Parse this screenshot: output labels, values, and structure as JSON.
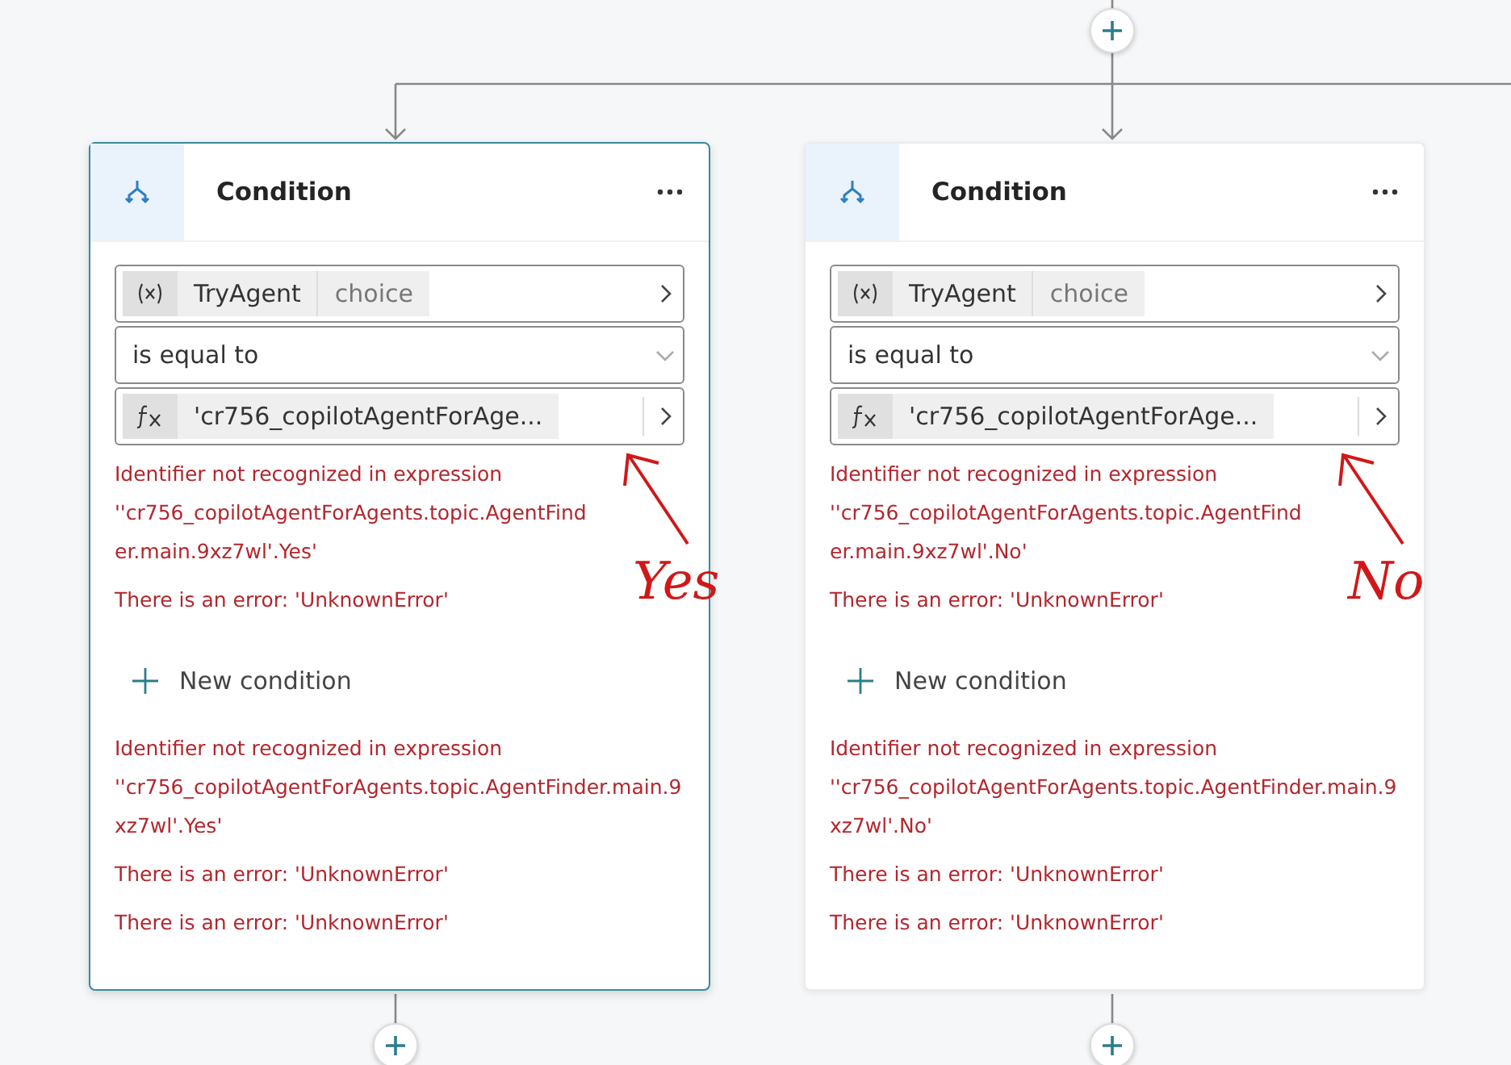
{
  "branches": [
    {
      "title": "Condition",
      "selected": true,
      "variable": {
        "name": "TryAgent",
        "type": "choice"
      },
      "operator": "is equal to",
      "value": "'cr756_copilotAgentForAge...",
      "errors_top": [
        "Identifier not recognized in expression ''cr756_copilotAgentForAgents.topic.AgentFinder.main.9xz7wl'.Yes'",
        "There is an error: 'UnknownError'"
      ],
      "new_condition": "New condition",
      "errors_bottom": [
        "Identifier not recognized in expression ''cr756_copilotAgentForAgents.topic.AgentFinder.main.9xz7wl'.Yes'",
        "There is an error: 'UnknownError'",
        "There is an error: 'UnknownError'"
      ],
      "annotation": "Yes"
    },
    {
      "title": "Condition",
      "selected": false,
      "variable": {
        "name": "TryAgent",
        "type": "choice"
      },
      "operator": "is equal to",
      "value": "'cr756_copilotAgentForAge...",
      "errors_top": [
        "Identifier not recognized in expression ''cr756_copilotAgentForAgents.topic.AgentFinder.main.9xz7wl'.No'",
        "There is an error: 'UnknownError'"
      ],
      "new_condition": "New condition",
      "errors_bottom": [
        "Identifier not recognized in expression ''cr756_copilotAgentForAgents.topic.AgentFinder.main.9xz7wl'.No'",
        "There is an error: 'UnknownError'",
        "There is an error: 'UnknownError'"
      ],
      "annotation": "No"
    }
  ]
}
